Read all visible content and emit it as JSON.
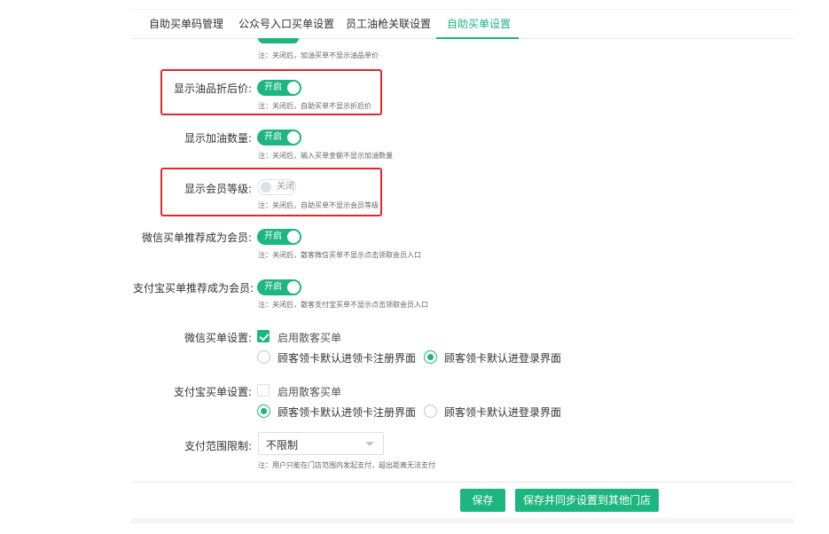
{
  "tabs": [
    {
      "label": "自助买单码管理",
      "active": false
    },
    {
      "label": "公众号入口买单设置",
      "active": false
    },
    {
      "label": "员工油枪关联设置",
      "active": false
    },
    {
      "label": "自助买单设置",
      "active": true
    }
  ],
  "settings": {
    "top_note": "注：关闭后，加油买单不显示油品单价",
    "discount_price": {
      "label": "显示油品折后价:",
      "toggle": "开启",
      "note": "注：关闭后，自助买单不显示折后价"
    },
    "fuel_quantity": {
      "label": "显示加油数量:",
      "toggle": "开启",
      "note": "注：关闭后，输入买单金额不显示加油数量"
    },
    "member_level": {
      "label": "显示会员等级:",
      "toggle": "关闭",
      "note": "注：关闭后，自助买单不显示会员等级"
    },
    "wechat_member": {
      "label": "微信买单推荐成为会员:",
      "toggle": "开启",
      "note": "注：关闭后，散客微信买单不显示点击领取会员入口"
    },
    "alipay_member": {
      "label": "支付宝买单推荐成为会员:",
      "toggle": "开启",
      "note": "注：关闭后，散客支付宝买单不显示点击领取会员入口"
    }
  },
  "wechat_pay": {
    "label": "微信买单设置:",
    "enable_label": "启用散客买单",
    "enabled": true,
    "options": [
      "顾客领卡默认进领卡注册界面",
      "顾客领卡默认进登录界面"
    ],
    "selected": 1
  },
  "alipay_pay": {
    "label": "支付宝买单设置:",
    "enable_label": "启用散客买单",
    "enabled": false,
    "options": [
      "顾客领卡默认进领卡注册界面",
      "顾客领卡默认进登录界面"
    ],
    "selected": 0
  },
  "pay_range": {
    "label": "支付范围限制:",
    "value": "不限制",
    "note": "注：用户只能在门店范围内发起支付，超出距离无法支付"
  },
  "buttons": {
    "save": "保存",
    "save_sync": "保存并同步设置到其他门店"
  },
  "colors": {
    "accent": "#1db67f",
    "highlight": "#e3262b"
  }
}
